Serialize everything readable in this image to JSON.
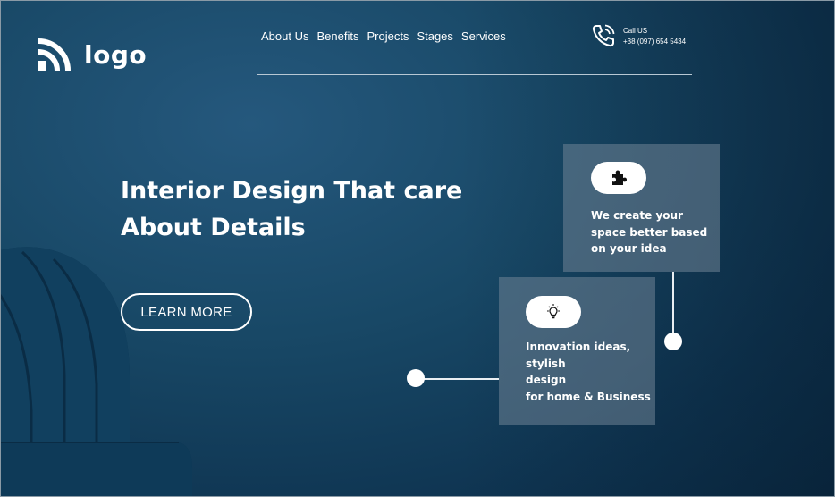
{
  "brand": {
    "logo_text": "logo",
    "logo_icon": "wifi-arcs-icon"
  },
  "nav": {
    "items": [
      "About Us",
      "Benefits",
      "Projects",
      "Stages",
      "Services"
    ]
  },
  "contact": {
    "label": "Call US",
    "phone": "+38 (097) 654 5434",
    "icon": "phone-icon"
  },
  "hero": {
    "title_line1": "Interior Design That care",
    "title_line2": "About Details",
    "cta_label": "LEARN MORE"
  },
  "features": [
    {
      "icon": "puzzle-icon",
      "line1": "We create your",
      "line2": "space better based",
      "line3": "on your idea"
    },
    {
      "icon": "lightbulb-icon",
      "line1": "Innovation ideas,",
      "line2": "stylish",
      "line3": "design",
      "line4": "for home & Business"
    }
  ],
  "colors": {
    "background": "#184866",
    "card": "#708496",
    "text": "#ffffff"
  }
}
